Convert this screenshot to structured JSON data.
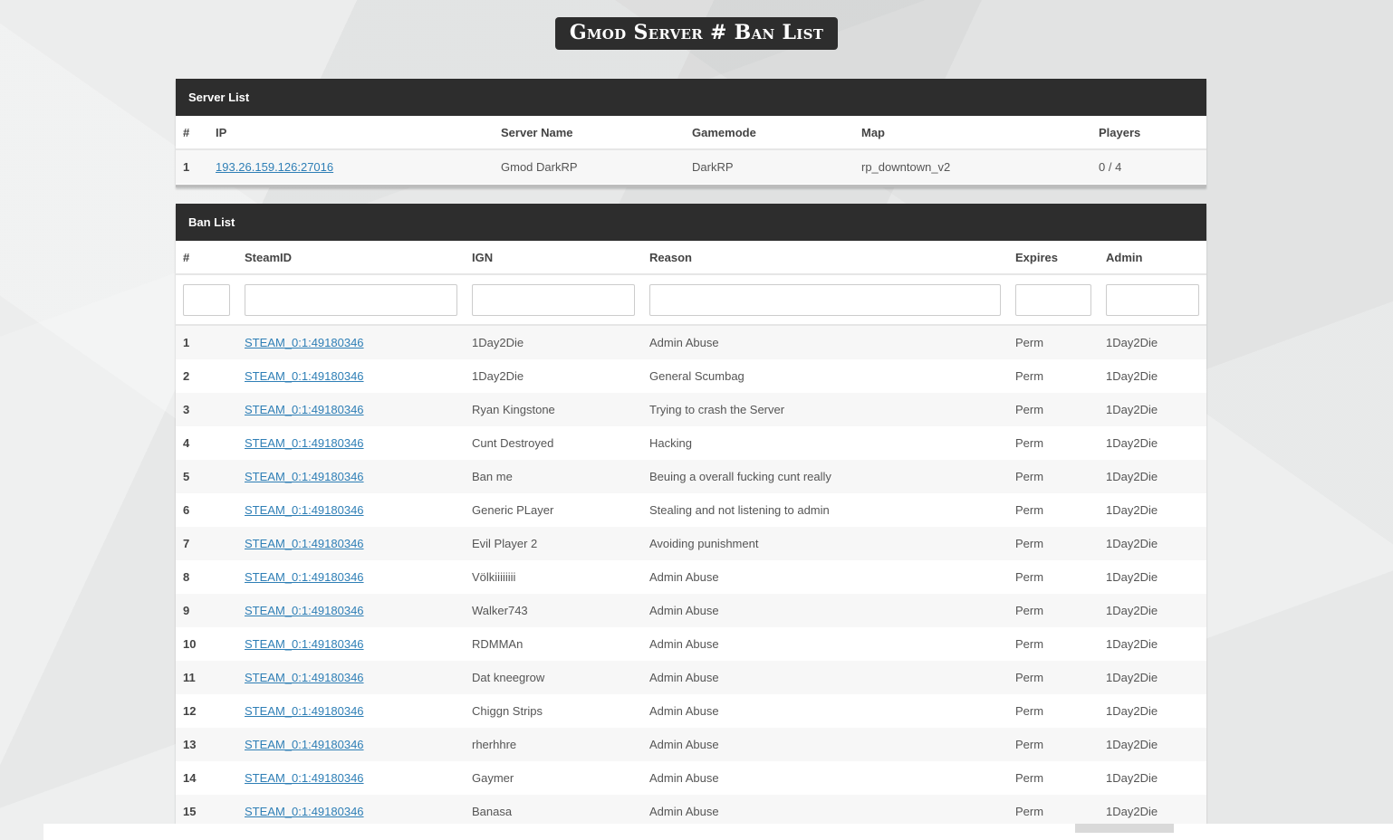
{
  "page_title": "Gmod Server # Ban List",
  "server_panel": {
    "title": "Server List",
    "columns": [
      "#",
      "IP",
      "Server Name",
      "Gamemode",
      "Map",
      "Players"
    ],
    "rows": [
      {
        "num": "1",
        "ip": "193.26.159.126:27016",
        "name": "Gmod DarkRP",
        "gamemode": "DarkRP",
        "map": "rp_downtown_v2",
        "players": "0 / 4"
      }
    ]
  },
  "ban_panel": {
    "title": "Ban List",
    "columns": [
      "#",
      "SteamID",
      "IGN",
      "Reason",
      "Expires",
      "Admin"
    ],
    "rows": [
      {
        "num": "1",
        "steamid": "STEAM_0:1:49180346",
        "ign": "1Day2Die",
        "reason": "Admin Abuse",
        "expires": "Perm",
        "admin": "1Day2Die"
      },
      {
        "num": "2",
        "steamid": "STEAM_0:1:49180346",
        "ign": "1Day2Die",
        "reason": "General Scumbag",
        "expires": "Perm",
        "admin": "1Day2Die"
      },
      {
        "num": "3",
        "steamid": "STEAM_0:1:49180346",
        "ign": "Ryan Kingstone",
        "reason": "Trying to crash the Server",
        "expires": "Perm",
        "admin": "1Day2Die"
      },
      {
        "num": "4",
        "steamid": "STEAM_0:1:49180346",
        "ign": "Cunt Destroyed",
        "reason": "Hacking",
        "expires": "Perm",
        "admin": "1Day2Die"
      },
      {
        "num": "5",
        "steamid": "STEAM_0:1:49180346",
        "ign": "Ban me",
        "reason": "Beuing a overall fucking cunt really",
        "expires": "Perm",
        "admin": "1Day2Die"
      },
      {
        "num": "6",
        "steamid": "STEAM_0:1:49180346",
        "ign": "Generic PLayer",
        "reason": "Stealing and not listening to admin",
        "expires": "Perm",
        "admin": "1Day2Die"
      },
      {
        "num": "7",
        "steamid": "STEAM_0:1:49180346",
        "ign": "Evil Player 2",
        "reason": "Avoiding punishment",
        "expires": "Perm",
        "admin": "1Day2Die"
      },
      {
        "num": "8",
        "steamid": "STEAM_0:1:49180346",
        "ign": "Völkiiiiiiii",
        "reason": "Admin Abuse",
        "expires": "Perm",
        "admin": "1Day2Die"
      },
      {
        "num": "9",
        "steamid": "STEAM_0:1:49180346",
        "ign": "Walker743",
        "reason": "Admin Abuse",
        "expires": "Perm",
        "admin": "1Day2Die"
      },
      {
        "num": "10",
        "steamid": "STEAM_0:1:49180346",
        "ign": "RDMMAn",
        "reason": "Admin Abuse",
        "expires": "Perm",
        "admin": "1Day2Die"
      },
      {
        "num": "11",
        "steamid": "STEAM_0:1:49180346",
        "ign": "Dat kneegrow",
        "reason": "Admin Abuse",
        "expires": "Perm",
        "admin": "1Day2Die"
      },
      {
        "num": "12",
        "steamid": "STEAM_0:1:49180346",
        "ign": "Chiggn Strips",
        "reason": "Admin Abuse",
        "expires": "Perm",
        "admin": "1Day2Die"
      },
      {
        "num": "13",
        "steamid": "STEAM_0:1:49180346",
        "ign": "rherhhre",
        "reason": "Admin Abuse",
        "expires": "Perm",
        "admin": "1Day2Die"
      },
      {
        "num": "14",
        "steamid": "STEAM_0:1:49180346",
        "ign": "Gaymer",
        "reason": "Admin Abuse",
        "expires": "Perm",
        "admin": "1Day2Die"
      },
      {
        "num": "15",
        "steamid": "STEAM_0:1:49180346",
        "ign": "Banasa",
        "reason": "Admin Abuse",
        "expires": "Perm",
        "admin": "1Day2Die"
      }
    ]
  }
}
